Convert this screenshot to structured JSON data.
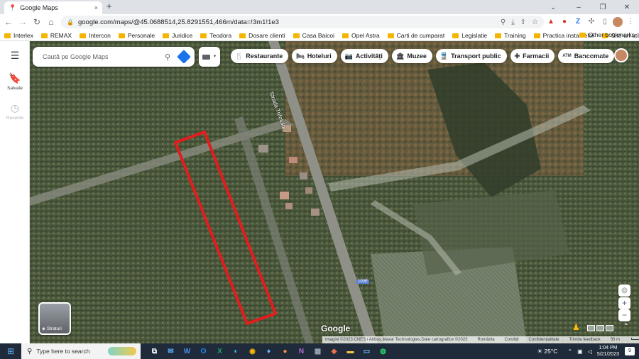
{
  "browser": {
    "tab_title": "Google Maps",
    "tab_close": "×",
    "new_tab": "+",
    "url": "google.com/maps/@45.0688514,25.8291551,466m/data=!3m1!1e3",
    "window_controls": {
      "caret": "⌄",
      "minimize": "–",
      "maximize": "❐",
      "close": "✕"
    }
  },
  "bookmarks": {
    "items": [
      "Interlex",
      "REMAX",
      "Intercon",
      "Personale",
      "Juridice",
      "Teodora",
      "Dosare clienti",
      "Casa Baicoi",
      "Opel Astra",
      "Carti de cumparat",
      "Legislatie",
      "Training",
      "Practica instantelor",
      "Site-uri utile"
    ],
    "overflow": "»",
    "other": "Other bookmarks"
  },
  "maps": {
    "rail": {
      "saved_label": "Salvate",
      "recents_label": "Recente"
    },
    "search": {
      "placeholder": "Caută pe Google Maps"
    },
    "chips": [
      {
        "icon": "🍴",
        "label": "Restaurante"
      },
      {
        "icon": "🛏",
        "label": "Hoteluri"
      },
      {
        "icon": "📷",
        "label": "Activități"
      },
      {
        "icon": "🏛",
        "label": "Muzee"
      },
      {
        "icon": "🚆",
        "label": "Transport public"
      },
      {
        "icon": "✚",
        "label": "Farmacii"
      },
      {
        "icon": "ATM",
        "label": "Bancomate"
      }
    ],
    "layers_label": "Straturi",
    "street_label": "Strada Trifoiului",
    "road_badge": "100E",
    "logo": "Google",
    "attribution": {
      "imagery": "Imagini ©2023 CNES / Airbus,Maxar Technologies,Date cartografice ©2023",
      "country": "România",
      "terms": "Condiții",
      "privacy": "Confidențialitate",
      "feedback": "Trimite feedback",
      "scale": "50 m"
    },
    "colors": {
      "outline": "#e21d1d",
      "accent": "#1a73e8"
    }
  },
  "taskbar": {
    "search_placeholder": "Type here to search",
    "weather": "25°C",
    "time": "1:04 PM",
    "date": "5/21/2023",
    "notifications": "9"
  }
}
